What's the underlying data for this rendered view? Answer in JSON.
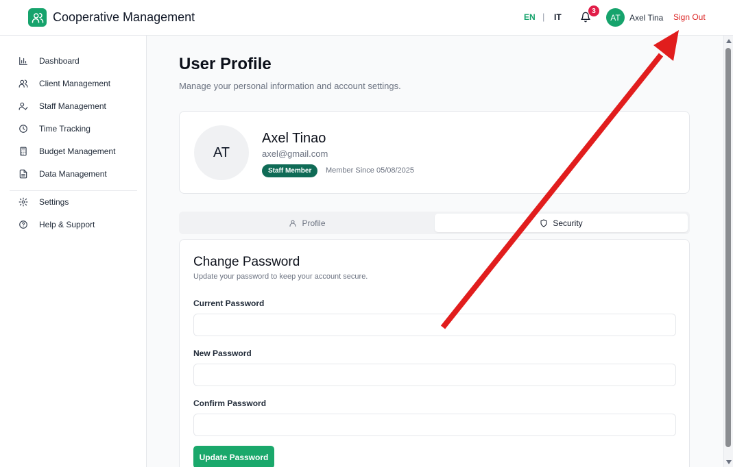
{
  "header": {
    "app_title": "Cooperative Management",
    "logo_icon": "users-icon",
    "lang_en": "EN",
    "lang_separator": "|",
    "lang_it": "IT",
    "notification_count": "3",
    "avatar_initials": "AT",
    "user_name": "Axel Tina",
    "sign_out": "Sign Out"
  },
  "sidebar": {
    "items": [
      {
        "label": "Dashboard",
        "icon": "bar-chart-icon"
      },
      {
        "label": "Client Management",
        "icon": "users-icon"
      },
      {
        "label": "Staff Management",
        "icon": "user-check-icon"
      },
      {
        "label": "Time Tracking",
        "icon": "clock-icon"
      },
      {
        "label": "Budget Management",
        "icon": "calculator-icon"
      },
      {
        "label": "Data Management",
        "icon": "file-icon"
      },
      {
        "label": "Settings",
        "icon": "gear-icon"
      },
      {
        "label": "Help & Support",
        "icon": "help-circle-icon"
      }
    ]
  },
  "page": {
    "title": "User Profile",
    "subtitle": "Manage your personal information and account settings."
  },
  "profile": {
    "initials": "AT",
    "name": "Axel Tinao",
    "email": "axel@gmail.com",
    "role_badge": "Staff Member",
    "member_since": "Member Since 05/08/2025"
  },
  "tabs": {
    "profile": "Profile",
    "security": "Security",
    "active": "Security"
  },
  "password_form": {
    "title": "Change Password",
    "subtitle": "Update your password to keep your account secure.",
    "current_label": "Current Password",
    "current_value": "",
    "new_label": "New Password",
    "new_value": "",
    "confirm_label": "Confirm Password",
    "confirm_value": "",
    "submit_label": "Update Password"
  },
  "colors": {
    "brand": "#16a36c",
    "sign_out": "#dc2626",
    "badge": "#0f6b56",
    "notification": "#e11d48",
    "annotation_arrow": "#e11d1d"
  }
}
